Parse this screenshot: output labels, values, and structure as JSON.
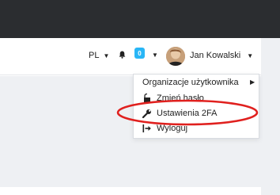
{
  "header": {
    "language": "PL",
    "notification_count": "0",
    "user_name": "Jan Kowalski"
  },
  "user_menu": {
    "items": [
      {
        "label": "Organizacje użytkownika",
        "icon": "submenu-arrow-icon"
      },
      {
        "label": "Zmień hasło",
        "icon": "lock-icon"
      },
      {
        "label": "Ustawienia 2FA",
        "icon": "wrench-icon"
      },
      {
        "label": "Wyloguj",
        "icon": "logout-icon"
      }
    ]
  },
  "colors": {
    "topbar": "#2b2d30",
    "badge": "#29b6f6",
    "annotation": "#e0201e",
    "content_bg": "#eef0f3"
  },
  "icons": {
    "notification": "bell-icon",
    "language_caret": "caret-down-icon",
    "user_caret": "caret-down-icon"
  }
}
